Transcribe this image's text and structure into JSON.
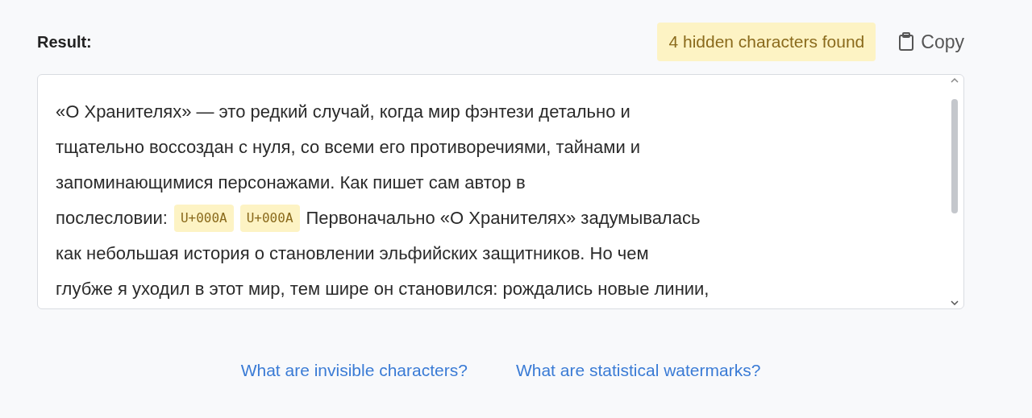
{
  "result_label": "Result:",
  "badge": "4 hidden characters found",
  "copy_button": "Copy",
  "text_lines": [
    [
      {
        "kind": "text",
        "text": "«О Хранителях» — это редкий случай, когда мир фэнтези детально и"
      }
    ],
    [
      {
        "kind": "text",
        "text": "тщательно воссоздан с нуля, со всеми его противоречиями, тайнами и"
      }
    ],
    [
      {
        "kind": "text",
        "text": "запоминающимися персонажами. Как пишет сам автор в"
      }
    ],
    [
      {
        "kind": "text",
        "text": "послесловии:"
      },
      {
        "kind": "code",
        "text": "U+000A"
      },
      {
        "kind": "code",
        "text": "U+000A"
      },
      {
        "kind": "text",
        "text": "Первоначально «О Хранителях» задумывалась"
      }
    ],
    [
      {
        "kind": "text",
        "text": "как небольшая история о становлении эльфийских защитников. Но чем"
      }
    ],
    [
      {
        "kind": "text",
        "text": "глубже я уходил в этот мир, тем шире он становился: рождались новые линии,"
      }
    ]
  ],
  "links": [
    "What are invisible characters?",
    "What are statistical watermarks?"
  ]
}
